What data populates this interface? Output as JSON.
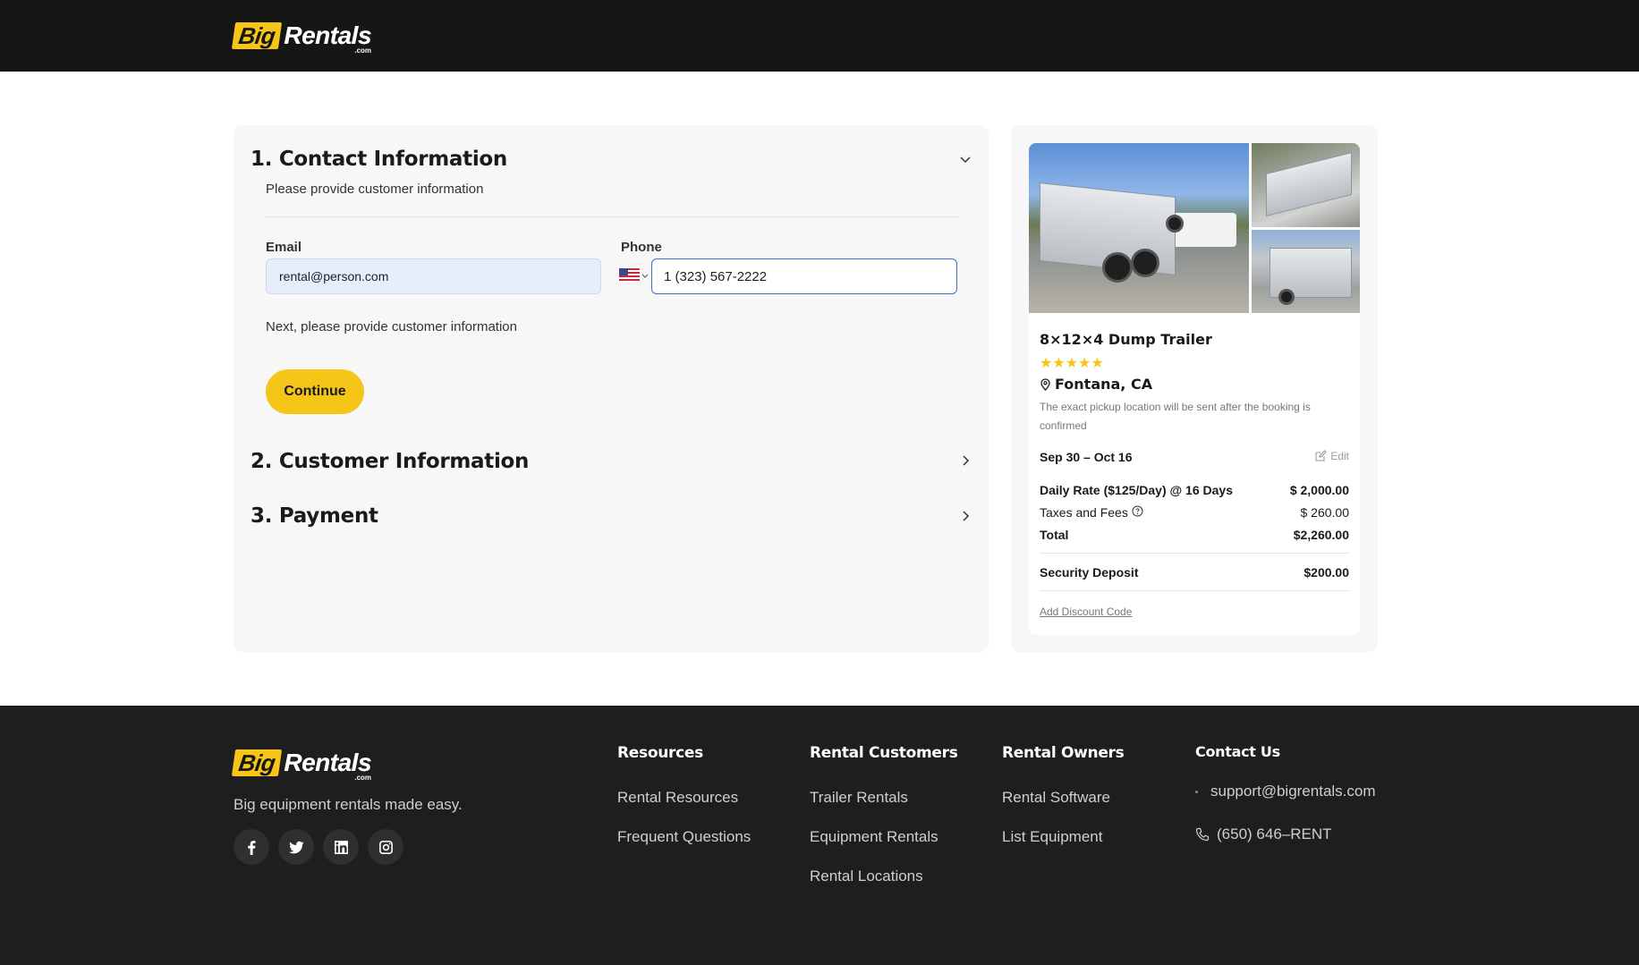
{
  "brand": {
    "logo_big": "Big",
    "logo_rentals": "Rentals",
    "logo_com": ".com",
    "accent": "#f5c518",
    "dark": "#161616"
  },
  "checkout": {
    "contact": {
      "title": "1. Contact Information",
      "subtitle": "Please provide customer information",
      "email_label": "Email",
      "email_value": "rental@person.com",
      "phone_label": "Phone",
      "phone_value": "1 (323) 567-2222",
      "phone_country_icon": "us-flag-icon",
      "next_text": "Next, please provide customer information",
      "continue_label": "Continue",
      "expanded": true
    },
    "customer": {
      "title": "2. Customer Information"
    },
    "payment": {
      "title": "3. Payment"
    }
  },
  "summary": {
    "item_title": "8×12×4 Dump Trailer",
    "rating_stars": 5,
    "stars_text": "★★★★★",
    "location": "Fontana, CA",
    "pickup_note": "The exact pickup location will be sent after the booking is confirmed",
    "dates": "Sep 30 – Oct 16",
    "edit_label": "Edit",
    "daily_rate_label": "Daily Rate ($125/Day) @ 16 Days",
    "daily_rate_value": "$ 2,000.00",
    "taxes_label": "Taxes and Fees",
    "taxes_value": "$ 260.00",
    "total_label": "Total",
    "total_value": "$2,260.00",
    "deposit_label": "Security Deposit",
    "deposit_value": "$200.00",
    "discount_label": "Add Discount Code"
  },
  "footer": {
    "tagline": "Big equipment rentals made easy.",
    "social": [
      "facebook-icon",
      "twitter-icon",
      "linkedin-icon",
      "instagram-icon"
    ],
    "resources": {
      "heading": "Resources",
      "links": [
        "Rental Resources",
        "Frequent Questions"
      ]
    },
    "rental_customers": {
      "heading": "Rental Customers",
      "links": [
        "Trailer Rentals",
        "Equipment Rentals",
        "Rental Locations"
      ]
    },
    "rental_owners": {
      "heading": "Rental Owners",
      "links": [
        "Rental Software",
        "List Equipment"
      ]
    },
    "contact": {
      "heading": "Contact Us",
      "email": "support@bigrentals.com",
      "phone": "(650) 646–RENT"
    }
  }
}
